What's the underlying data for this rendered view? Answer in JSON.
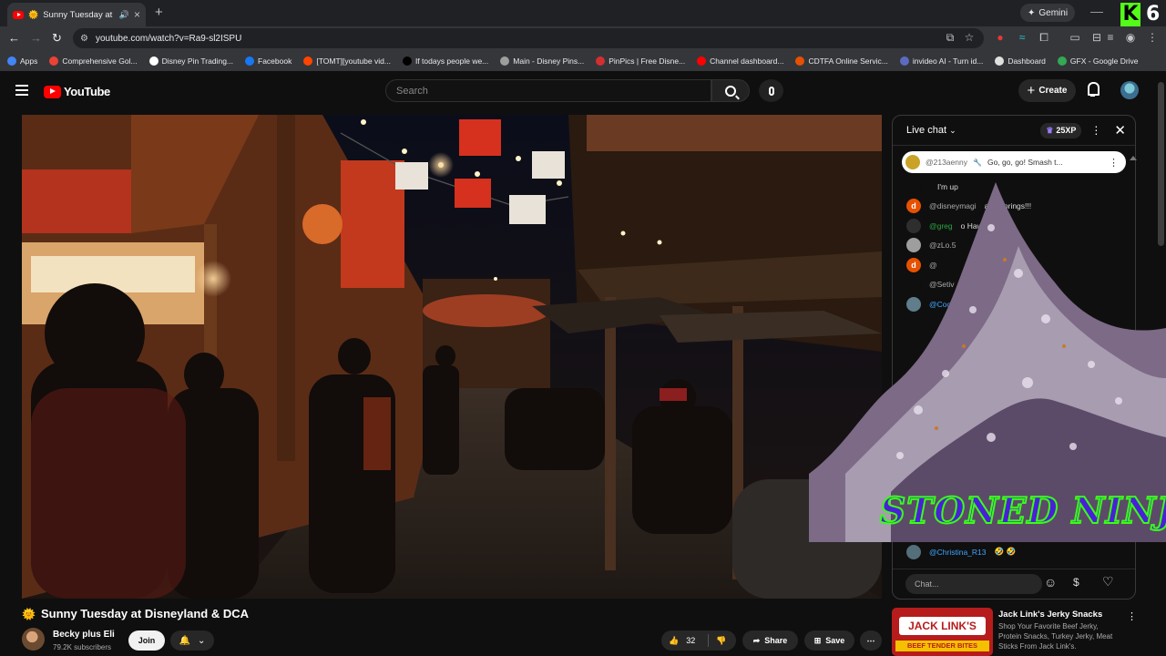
{
  "browser": {
    "tab_title": "Sunny Tuesday at Disne",
    "gemini_label": "Gemini",
    "url": "youtube.com/watch?v=Ra9-sl2ISPU",
    "kick_number": "6",
    "bookmarks": [
      {
        "label": "Apps",
        "color": "#4285f4"
      },
      {
        "label": "Comprehensive Gol...",
        "color": "#ea4335"
      },
      {
        "label": "Disney Pin Trading...",
        "color": "#ffffff"
      },
      {
        "label": "Facebook",
        "color": "#1877f2"
      },
      {
        "label": "[TOMT][youtube vid...",
        "color": "#ff4500"
      },
      {
        "label": "If todays people we...",
        "color": "#000000"
      },
      {
        "label": "Main - Disney Pins...",
        "color": "#9e9e9e"
      },
      {
        "label": "PinPics | Free Disne...",
        "color": "#d32f2f"
      },
      {
        "label": "Channel dashboard...",
        "color": "#ff0000"
      },
      {
        "label": "CDTFA Online Servic...",
        "color": "#e65100"
      },
      {
        "label": "invideo AI - Turn id...",
        "color": "#5c6bc0"
      },
      {
        "label": "Dashboard",
        "color": "#e0e0e0"
      },
      {
        "label": "GFX - Google Drive",
        "color": "#34a853"
      }
    ]
  },
  "youtube": {
    "logo_text": "YouTube",
    "search_placeholder": "Search",
    "create_label": "Create"
  },
  "chat": {
    "header": "Live chat",
    "xp_badge": "25XP",
    "pinned_author": "@213aenny",
    "pinned_text": "Go, go, go! Smash t...",
    "messages": [
      {
        "author": "",
        "text": "I'm up",
        "avatar_color": "#0f0f0f",
        "avatar_letter": "",
        "style": ""
      },
      {
        "author": "@disneymagi",
        "text": "ator springs!!!",
        "avatar_color": "#e65100",
        "avatar_letter": "d",
        "style": ""
      },
      {
        "author": "@greg",
        "text": "o Hawks",
        "avatar_color": "#2e2e2e",
        "avatar_letter": "",
        "style": "green"
      },
      {
        "author": "@zLo.5",
        "text": "",
        "avatar_color": "#9e9e9e",
        "avatar_letter": "",
        "style": ""
      },
      {
        "author": "@",
        "text": "",
        "avatar_color": "#e65100",
        "avatar_letter": "d",
        "style": ""
      },
      {
        "author": "@Setiv",
        "text": "",
        "avatar_color": "#0f0f0f",
        "avatar_letter": "",
        "style": ""
      },
      {
        "author": "@Coc",
        "text": "",
        "avatar_color": "#607d8b",
        "avatar_letter": "",
        "style": "blue"
      }
    ],
    "last_author": "@Christina_R13",
    "last_text": "🤣 🤣",
    "input_placeholder": "Chat..."
  },
  "overlay": {
    "text": "STONED NINJA"
  },
  "video": {
    "title": "Sunny Tuesday at Disneyland & DCA",
    "channel": "Becky plus Eli",
    "subscribers": "79.2K subscribers",
    "join_label": "Join",
    "likes": "32",
    "share_label": "Share",
    "save_label": "Save"
  },
  "ad": {
    "brand": "JACK LINK'S",
    "thumb_sub": "BEEF TENDER BITES",
    "title": "Jack Link's Jerky Snacks",
    "description": "Shop Your Favorite Beef Jerky, Protein Snacks, Turkey Jerky, Meat Sticks From Jack Link's."
  }
}
